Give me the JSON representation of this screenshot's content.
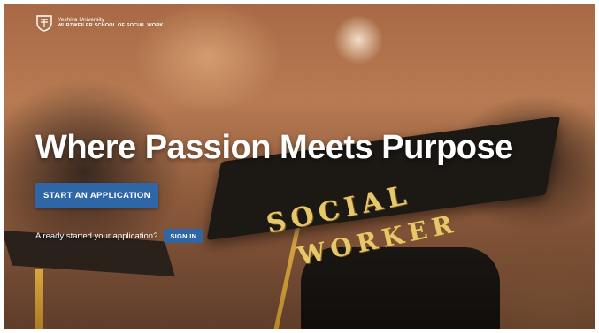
{
  "brand": {
    "university": "Yeshiva University",
    "school": "WURZWEILER SCHOOL OF SOCIAL WORK",
    "logo_icon": "shield-icon"
  },
  "hero": {
    "headline": "Where Passion Meets Purpose",
    "cap_text_line1": "SOCIAL",
    "cap_text_line2": "WORKER"
  },
  "actions": {
    "start_application_label": "START AN APPLICATION",
    "already_started_text": "Already started your application?",
    "sign_in_label": "SIGN IN"
  },
  "colors": {
    "button_blue": "#2f67a6",
    "headline_text": "#ffffff"
  }
}
